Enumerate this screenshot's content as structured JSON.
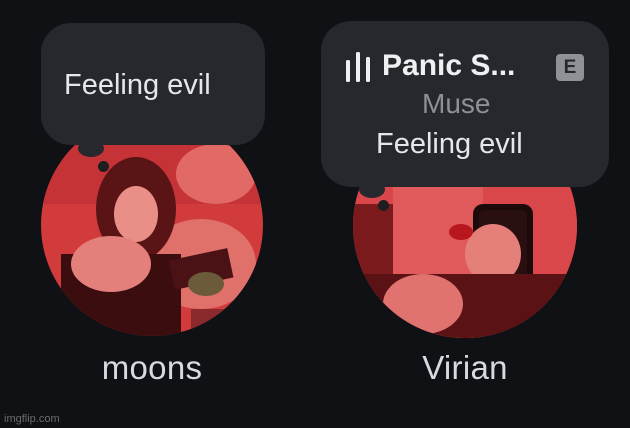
{
  "friends": [
    {
      "name": "moons",
      "note": "Feeling evil"
    },
    {
      "name": "Virian",
      "note": "Feeling evil",
      "song": {
        "title": "Panic S...",
        "artist": "Muse",
        "explicit_badge": "E",
        "icon": "music-bars-icon"
      }
    }
  ],
  "watermark": "imgflip.com",
  "colors": {
    "background": "#0f1114",
    "bubble": "#26282d",
    "avatar_tint": "#d8393b",
    "name_text": "#d8dadf",
    "muted_text": "#8e9096"
  }
}
